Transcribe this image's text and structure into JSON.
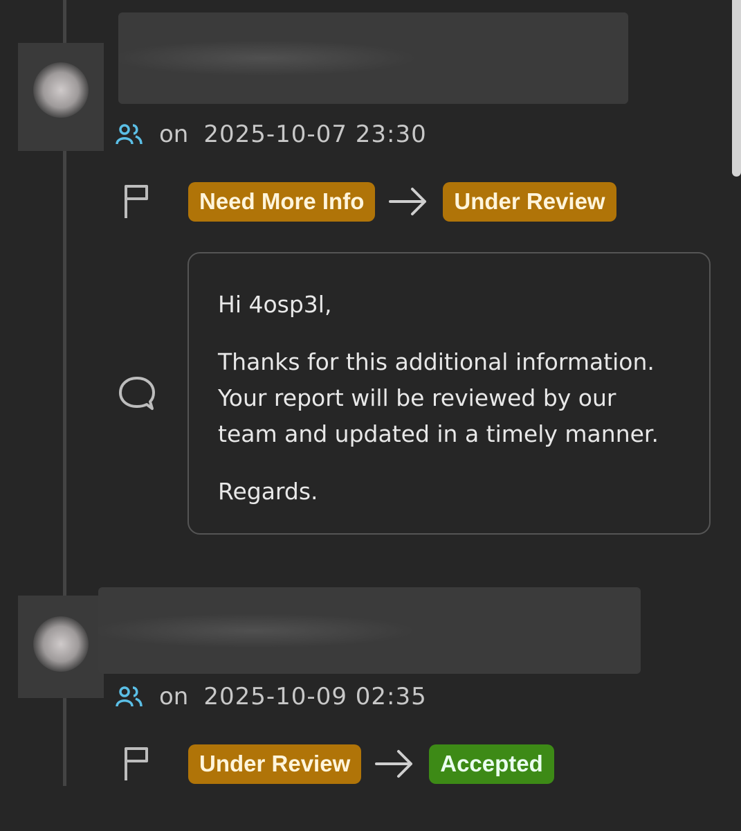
{
  "entries": [
    {
      "on_label": "on",
      "timestamp": "2025-10-07 23:30",
      "status_from": "Need More Info",
      "status_to": "Under Review",
      "comment": {
        "greeting": "Hi 4osp3l,",
        "body": "Thanks for this additional information. Your report will be reviewed by our team and updated in a timely manner.",
        "closing": "Regards."
      }
    },
    {
      "on_label": "on",
      "timestamp": "2025-10-09 02:35",
      "status_from": "Under Review",
      "status_to": "Accepted"
    }
  ],
  "icons": {
    "team": "team-icon",
    "flag": "flag-icon",
    "arrow": "arrow-right-icon",
    "comment": "comment-bubble-icon"
  },
  "colors": {
    "background": "#262626",
    "badge_pending": "#b07408",
    "badge_accepted": "#3d8a16",
    "team_icon": "#5bbfe6"
  }
}
